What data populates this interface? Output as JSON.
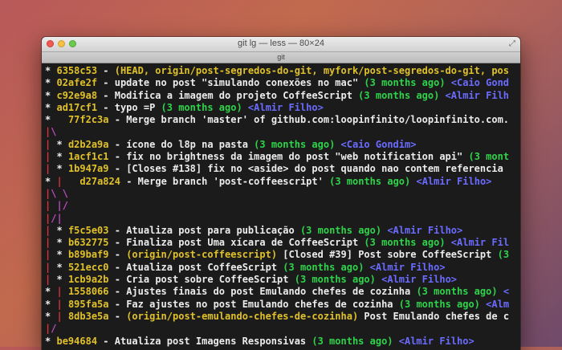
{
  "window": {
    "title": "git lg — less — 80×24",
    "tab": "git"
  },
  "colors": {
    "hash": "#e0c12a",
    "date": "#2fd34a",
    "author": "#6b6bff",
    "graph_red": "#e0303a",
    "graph_magenta": "#c04bc4",
    "text": "#e6e6e6",
    "background": "#1b1b1b"
  },
  "log": [
    {
      "graph": "* ",
      "hash": "6358c53",
      "sep": " - ",
      "ref": "(HEAD, origin/post-segredos-do-git, myfork/post-segredos-do-git, pos",
      "msg": "",
      "date": "",
      "author": ""
    },
    {
      "graph": "* ",
      "hash": "02afe2f",
      "sep": " - ",
      "ref": "",
      "msg": "update no post \"simulando conexões no mac\" ",
      "date": "(3 months ago) ",
      "author": "<Caio Gond"
    },
    {
      "graph": "* ",
      "hash": "c92e9a8",
      "sep": " - ",
      "ref": "",
      "msg": "Modifica a imagem do projeto CoffeeScript ",
      "date": "(3 months ago) ",
      "author": "<Almir Filh"
    },
    {
      "graph": "* ",
      "hash": "ad17cf1",
      "sep": " - ",
      "ref": "",
      "msg": "typo =P ",
      "date": "(3 months ago) ",
      "author": "<Almir Filho>"
    },
    {
      "graph": "*   ",
      "hash": "77f2c3a",
      "sep": " - ",
      "ref": "",
      "msg": "Merge branch 'master' of github.com:loopinfinito/loopinfinito.com.",
      "date": "",
      "author": ""
    },
    {
      "graph": "|\\",
      "hash": "",
      "sep": "",
      "ref": "",
      "msg": "",
      "date": "",
      "author": ""
    },
    {
      "graph": "| * ",
      "hash": "d2b2a9a",
      "sep": " - ",
      "ref": "",
      "msg": "ícone do l8p na pasta ",
      "date": "(3 months ago) ",
      "author": "<Caio Gondim>"
    },
    {
      "graph": "| * ",
      "hash": "1acf1c1",
      "sep": " - ",
      "ref": "",
      "msg": "fix no brightness da imagem do post \"web notification api\" ",
      "date": "(3 mont",
      "author": ""
    },
    {
      "graph": "| * ",
      "hash": "1b947a9",
      "sep": " - ",
      "ref": "",
      "msg": "[Closes #138] fix no <aside> do post quando nao contem referencia",
      "date": "",
      "author": ""
    },
    {
      "graph": "* |   ",
      "hash": "d27a824",
      "sep": " - ",
      "ref": "",
      "msg": "Merge branch 'post-coffeescript' ",
      "date": "(3 months ago) ",
      "author": "<Almir Filho>"
    },
    {
      "graph": "|\\ \\",
      "hash": "",
      "sep": "",
      "ref": "",
      "msg": "",
      "date": "",
      "author": ""
    },
    {
      "graph": "| |/",
      "hash": "",
      "sep": "",
      "ref": "",
      "msg": "",
      "date": "",
      "author": ""
    },
    {
      "graph": "|/|",
      "hash": "",
      "sep": "",
      "ref": "",
      "msg": "",
      "date": "",
      "author": ""
    },
    {
      "graph": "| * ",
      "hash": "f5c5e03",
      "sep": " - ",
      "ref": "",
      "msg": "Atualiza post para publicação ",
      "date": "(3 months ago) ",
      "author": "<Almir Filho>"
    },
    {
      "graph": "| * ",
      "hash": "b632775",
      "sep": " - ",
      "ref": "",
      "msg": "Finaliza post Uma xícara de CoffeeScript ",
      "date": "(3 months ago) ",
      "author": "<Almir Fil"
    },
    {
      "graph": "| * ",
      "hash": "b89baf9",
      "sep": " - ",
      "ref": "(origin/post-coffeescript) ",
      "msg": "[Closed #39] Post sobre CoffeeScript ",
      "date": "(3",
      "author": ""
    },
    {
      "graph": "| * ",
      "hash": "521ecc0",
      "sep": " - ",
      "ref": "",
      "msg": "Atualiza post CoffeeScript ",
      "date": "(3 months ago) ",
      "author": "<Almir Filho>"
    },
    {
      "graph": "| * ",
      "hash": "1cb9a2b",
      "sep": " - ",
      "ref": "",
      "msg": "Cria post sobre CoffeeScript ",
      "date": "(3 months ago) ",
      "author": "<Almir Filho>"
    },
    {
      "graph": "* | ",
      "hash": "1558066",
      "sep": " - ",
      "ref": "",
      "msg": "Ajustes finais do post Emulando chefes de cozinha ",
      "date": "(3 months ago) ",
      "author": "<"
    },
    {
      "graph": "* | ",
      "hash": "895fa5a",
      "sep": " - ",
      "ref": "",
      "msg": "Faz ajustes no post Emulando chefes de cozinha ",
      "date": "(3 months ago) ",
      "author": "<Alm"
    },
    {
      "graph": "* | ",
      "hash": "8db3e5a",
      "sep": " - ",
      "ref": "(origin/post-emulando-chefes-de-cozinha) ",
      "msg": "Post Emulando chefes de c",
      "date": "",
      "author": ""
    },
    {
      "graph": "|/",
      "hash": "",
      "sep": "",
      "ref": "",
      "msg": "",
      "date": "",
      "author": ""
    },
    {
      "graph": "* ",
      "hash": "be94684",
      "sep": " - ",
      "ref": "",
      "msg": "Atualiza post Imagens Responsivas ",
      "date": "(3 months ago) ",
      "author": "<Almir Filho>"
    }
  ]
}
